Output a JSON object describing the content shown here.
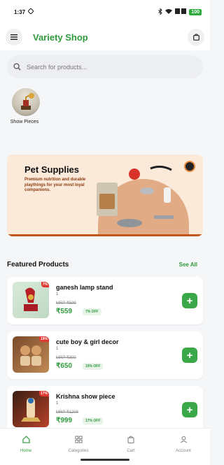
{
  "status_bar": {
    "time": "1:37",
    "battery": "100",
    "icons": [
      "location-icon",
      "bluetooth-icon",
      "wifi-icon",
      "signal-icon",
      "battery-icon"
    ]
  },
  "header": {
    "title": "Variety Shop",
    "icons": [
      "menu-icon",
      "shopping-bag-icon"
    ],
    "accent_color": "#2f9a3c"
  },
  "search": {
    "placeholder": "Search for products..."
  },
  "categories": [
    {
      "label": "Show Pieces"
    }
  ],
  "banner": {
    "title": "Pet Supplies",
    "subtitle": "Premium nutrition and durable playthings for your most loyal companions."
  },
  "featured": {
    "title": "Featured Products",
    "see_all": "See All",
    "products": [
      {
        "name": "ganesh lamp stand",
        "qty": "1",
        "mrp": "MRP ₹599",
        "price": "₹559",
        "discount_badge": "7%",
        "off": "7% OFF"
      },
      {
        "name": "cute boy & girl decor",
        "qty": "1",
        "mrp": "MRP ₹800",
        "price": "₹650",
        "discount_badge": "19%",
        "off": "19% OFF"
      },
      {
        "name": "Krishna show piece",
        "qty": "1",
        "mrp": "MRP ₹1200",
        "price": "₹999",
        "discount_badge": "17%",
        "off": "17% OFF"
      }
    ]
  },
  "bottom_nav": {
    "items": [
      {
        "label": "Home",
        "icon": "home-icon",
        "active": true
      },
      {
        "label": "Categories",
        "icon": "grid-icon",
        "active": false
      },
      {
        "label": "Cart",
        "icon": "shopping-bag-icon",
        "active": false
      },
      {
        "label": "Account",
        "icon": "user-icon",
        "active": false
      }
    ]
  }
}
